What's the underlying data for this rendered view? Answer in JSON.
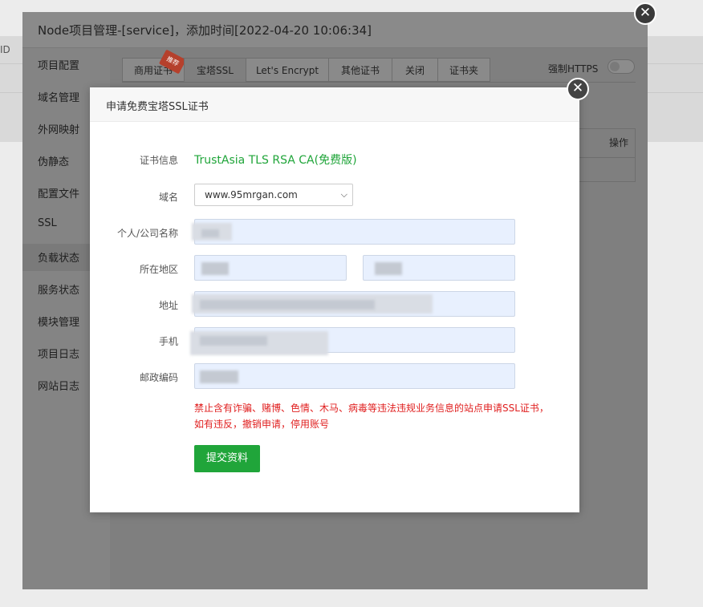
{
  "background": {
    "id_text": "ID"
  },
  "outer_dialog": {
    "title": "Node项目管理-[service]，添加时间[2022-04-20 10:06:34]",
    "sidebar": [
      "项目配置",
      "域名管理",
      "外网映射",
      "伪静态",
      "配置文件",
      "SSL",
      "负载状态",
      "服务状态",
      "模块管理",
      "项目日志",
      "网站日志"
    ],
    "tabs": [
      "商用证书",
      "宝塔SSL",
      "Let's Encrypt",
      "其他证书",
      "关闭",
      "证书夹"
    ],
    "hot_badge": "推荐",
    "force_https_label": "强制HTTPS",
    "table_op_header": "操作"
  },
  "modal": {
    "title": "申请免费宝塔SSL证书",
    "labels": {
      "cert_info": "证书信息",
      "domain": "域名",
      "name": "个人/公司名称",
      "region": "所在地区",
      "address": "地址",
      "phone": "手机",
      "postcode": "邮政编码"
    },
    "cert_info_value": "TrustAsia TLS RSA CA(免费版)",
    "domain_selected": "www.95mrgan.com",
    "warning_line1": "禁止含有诈骗、赌博、色情、木马、病毒等违法违规业务信息的站点申请SSL证书，",
    "warning_line2": "如有违反，撤销申请，停用账号",
    "submit_label": "提交资料"
  },
  "colors": {
    "accent": "#20a53a",
    "warning": "#e02020"
  }
}
